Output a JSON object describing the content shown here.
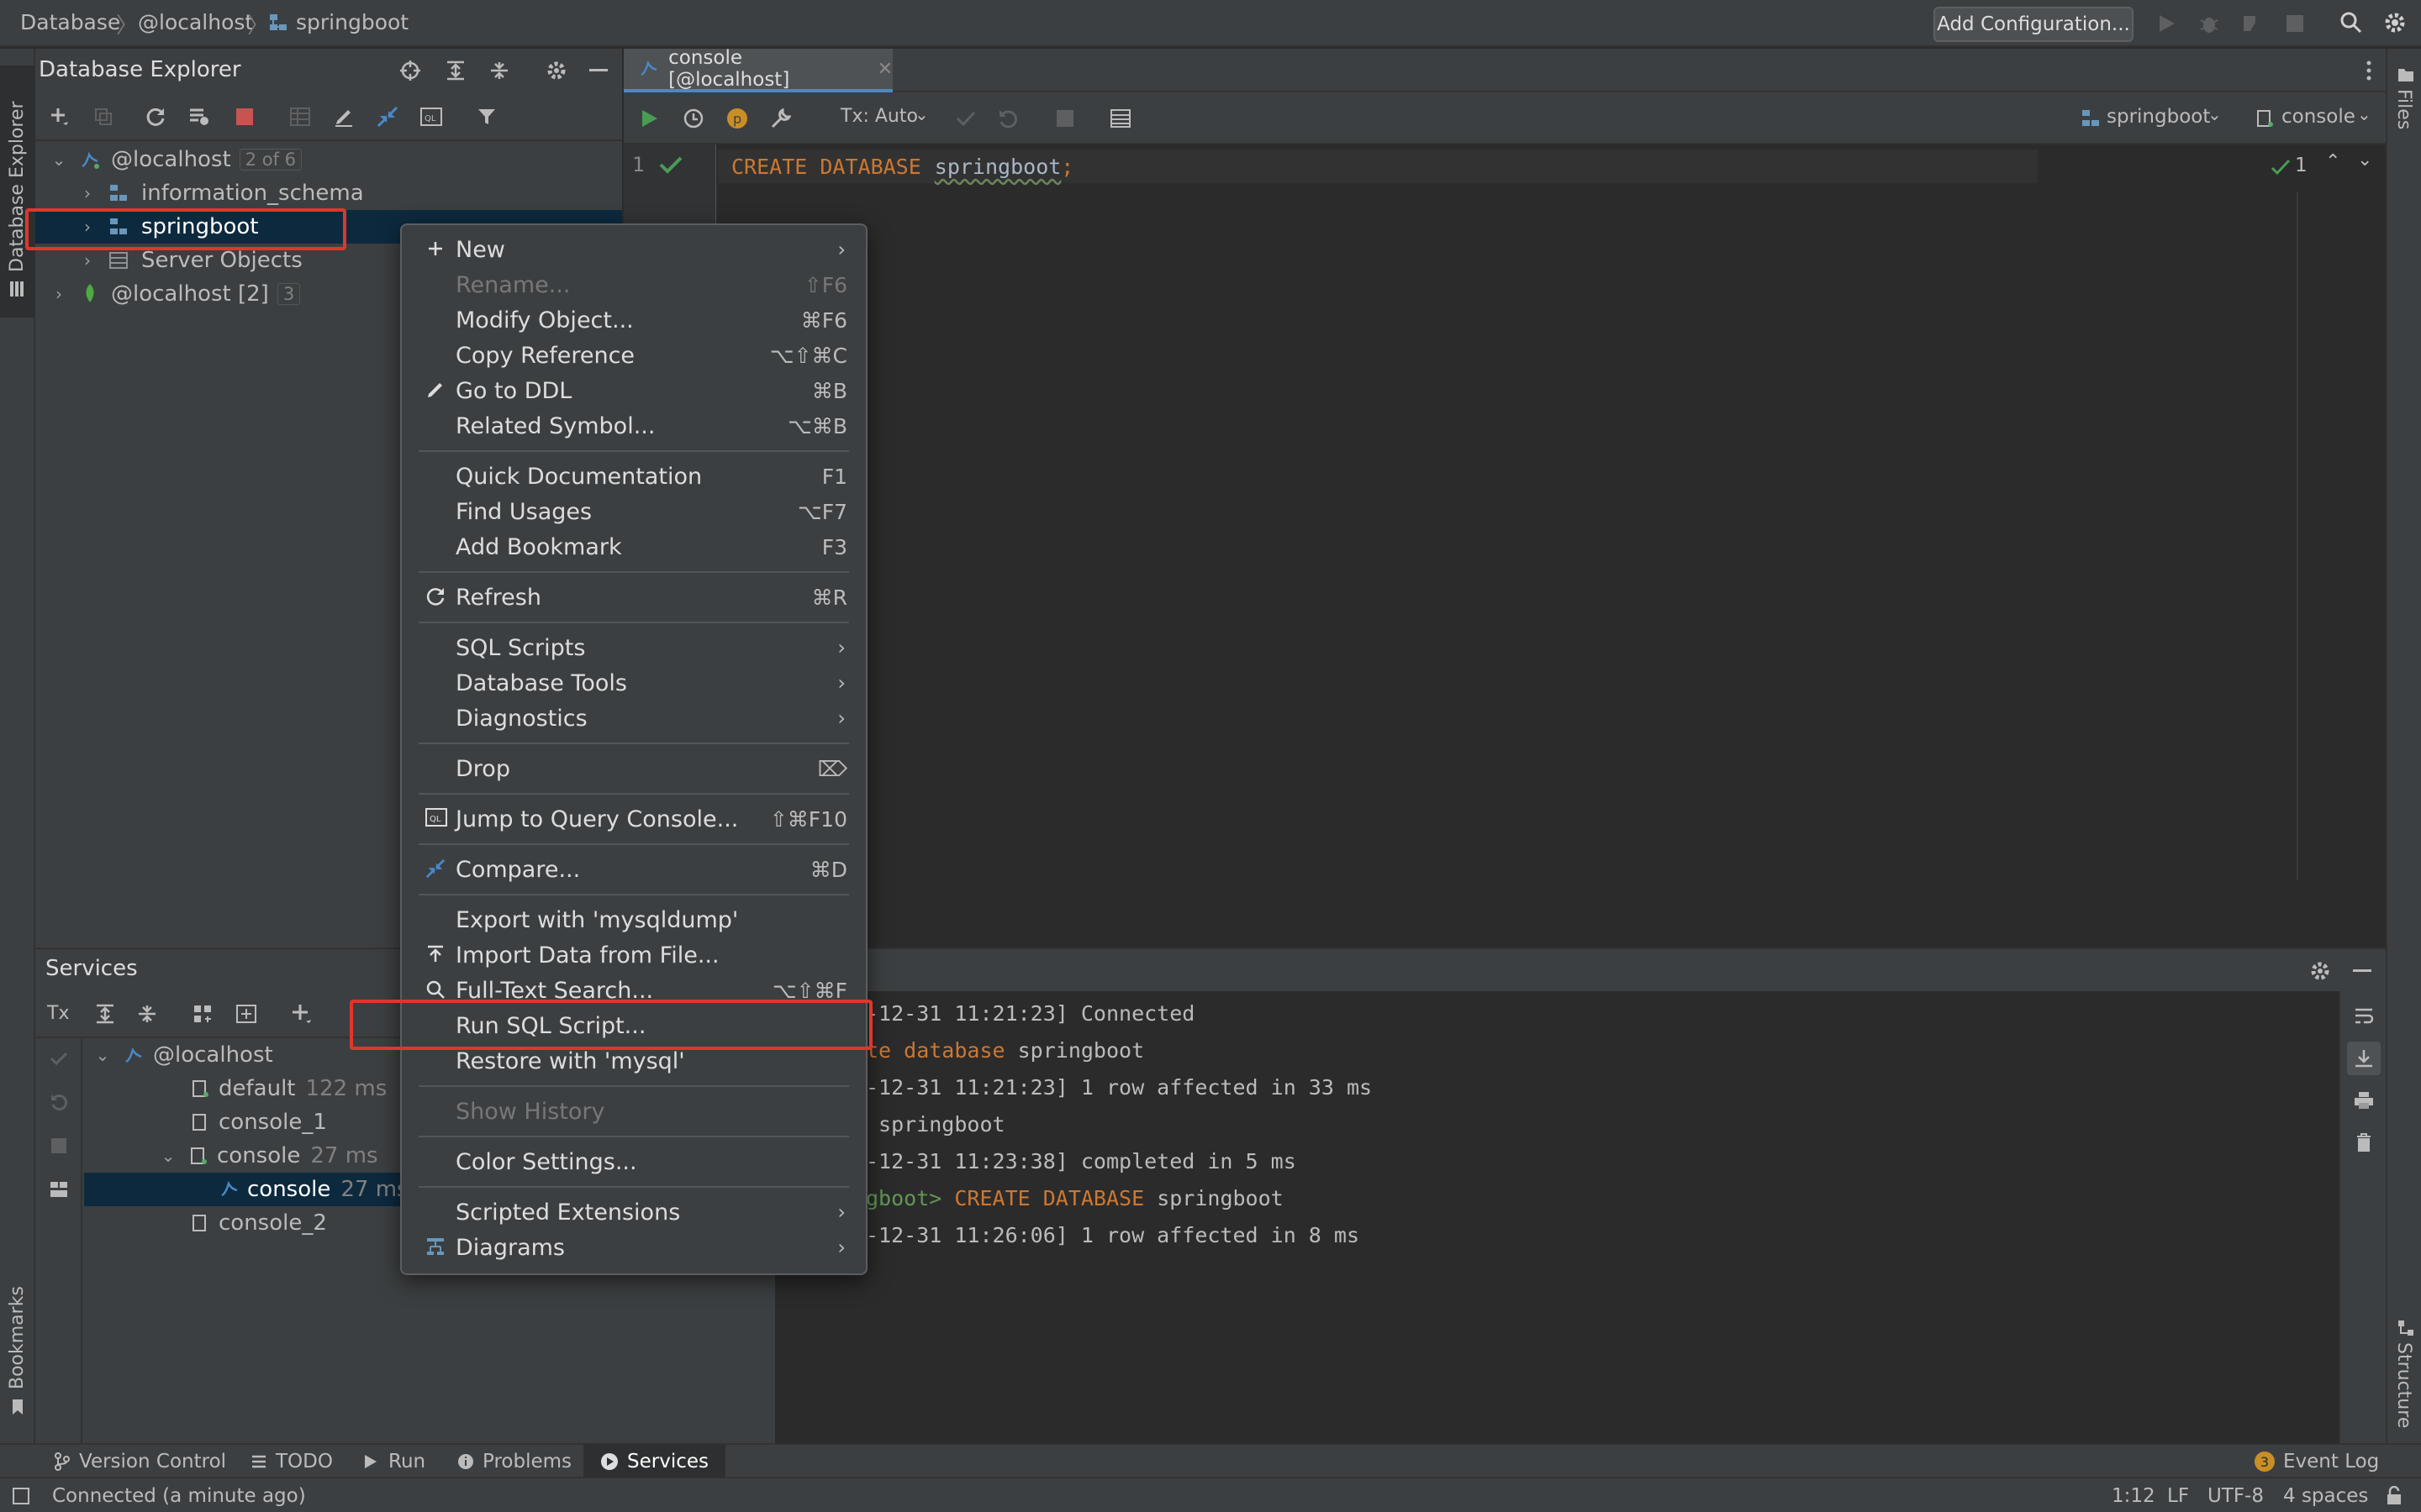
{
  "breadcrumb": [
    "Database",
    "@localhost",
    "springboot"
  ],
  "nav": {
    "add_configuration": "Add Configuration..."
  },
  "left_stripe": {
    "database_explorer": "Database Explorer",
    "bookmarks": "Bookmarks"
  },
  "right_stripe": {
    "files": "Files",
    "structure": "Structure"
  },
  "db_explorer": {
    "title": "Database Explorer",
    "tree": [
      {
        "label": "@localhost",
        "badge": "2 of 6"
      },
      {
        "label": "information_schema"
      },
      {
        "label": "springboot"
      },
      {
        "label": "Server Objects"
      },
      {
        "label": "@localhost [2]",
        "badge": "3"
      }
    ]
  },
  "editor": {
    "tab": "console [@localhost]",
    "tx_mode": "Tx: Auto",
    "schema_selector": "springboot",
    "session_selector": "console",
    "line_number": "1",
    "inspection_count": "1",
    "code": {
      "keyword": "CREATE DATABASE",
      "identifier": "springboot",
      "terminator": ";"
    }
  },
  "services": {
    "title": "Services",
    "tx_label": "Tx",
    "tree": [
      {
        "label": "@localhost"
      },
      {
        "label": "default",
        "time": "122 ms"
      },
      {
        "label": "console_1"
      },
      {
        "label": "console",
        "time": "27 ms"
      },
      {
        "label": "console",
        "time": "27 ms"
      },
      {
        "label": "console_2"
      }
    ]
  },
  "output": {
    "lines": [
      {
        "text": "-12-31 11:21:23] Connected"
      },
      {
        "kw": "te database",
        "rest": " springboot"
      },
      {
        "text": "-12-31 11:21:23] 1 row affected in 33 ms"
      },
      {
        "text": " springboot"
      },
      {
        "text": "-12-31 11:23:38] completed in 5 ms"
      },
      {
        "prompt": "gboot>",
        "kw": " CREATE DATABASE",
        "rest": " springboot"
      },
      {
        "text": "-12-31 11:26:06] 1 row affected in 8 ms"
      }
    ]
  },
  "context_menu": {
    "items": [
      {
        "label": "New",
        "submenu": "›"
      },
      {
        "label": "Rename...",
        "shortcut": "⇧F6",
        "disabled": true
      },
      {
        "label": "Modify Object...",
        "shortcut": "⌘F6"
      },
      {
        "label": "Copy Reference",
        "shortcut": "⌥⇧⌘C"
      },
      {
        "label": "Go to DDL",
        "shortcut": "⌘B"
      },
      {
        "label": "Related Symbol...",
        "shortcut": "⌥⌘B"
      },
      {
        "label": "Quick Documentation",
        "shortcut": "F1"
      },
      {
        "label": "Find Usages",
        "shortcut": "⌥F7"
      },
      {
        "label": "Add Bookmark",
        "shortcut": "F3"
      },
      {
        "label": "Refresh",
        "shortcut": "⌘R"
      },
      {
        "label": "SQL Scripts",
        "submenu": "›"
      },
      {
        "label": "Database Tools",
        "submenu": "›"
      },
      {
        "label": "Diagnostics",
        "submenu": "›"
      },
      {
        "label": "Drop",
        "shortcut": "⌦"
      },
      {
        "label": "Jump to Query Console...",
        "shortcut": "⇧⌘F10"
      },
      {
        "label": "Compare...",
        "shortcut": "⌘D"
      },
      {
        "label": "Export with 'mysqldump'"
      },
      {
        "label": "Import Data from File..."
      },
      {
        "label": "Full-Text Search...",
        "shortcut": "⌥⇧⌘F"
      },
      {
        "label": "Run SQL Script..."
      },
      {
        "label": "Restore with 'mysql'"
      },
      {
        "label": "Show History",
        "disabled": true
      },
      {
        "label": "Color Settings..."
      },
      {
        "label": "Scripted Extensions",
        "submenu": "›"
      },
      {
        "label": "Diagrams",
        "submenu": "›"
      }
    ]
  },
  "bottom_tools": [
    "Version Control",
    "TODO",
    "Run",
    "Problems",
    "Services",
    "Event Log"
  ],
  "event_log_count": "3",
  "status_bar": {
    "connection": "Connected (a minute ago)",
    "position": "1:12",
    "line_sep": "LF",
    "encoding": "UTF-8",
    "indent": "4 spaces"
  },
  "colors": {
    "accent": "#4a88c7",
    "highlight_red": "#e0362b",
    "keyword": "#cc7832",
    "run_green": "#499c54"
  }
}
